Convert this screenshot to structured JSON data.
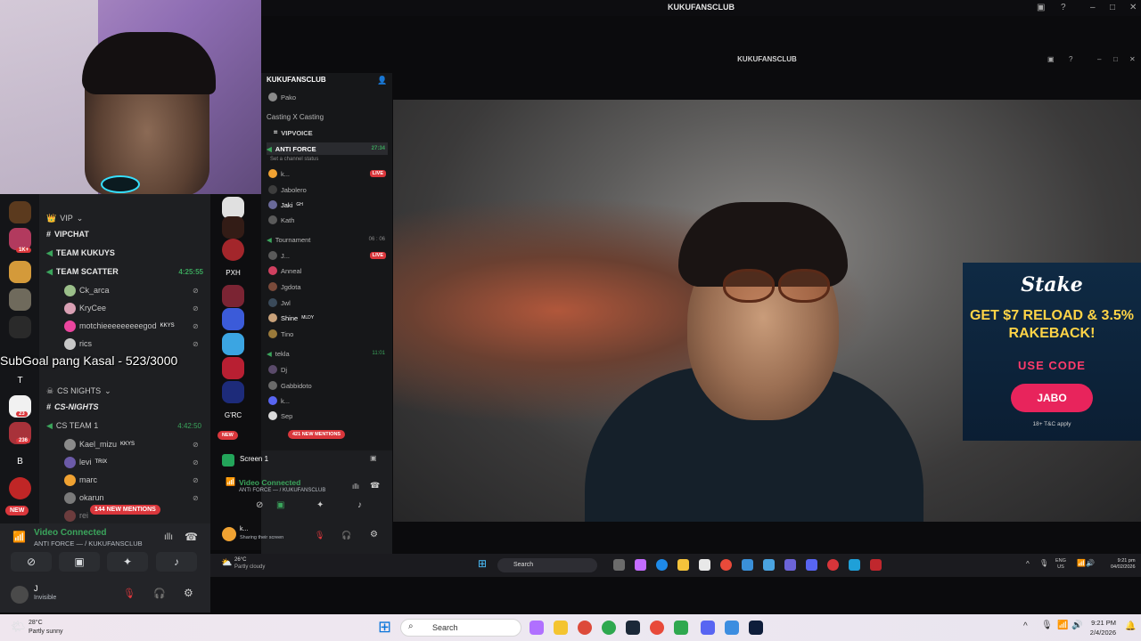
{
  "window": {
    "title": "KUKUFANSCLUB",
    "inner_title": "KUKUFANSCLUB"
  },
  "overlay": {
    "subgoal": "SubGoal pang Kasal - 523/3000"
  },
  "discord_left": {
    "guild_badges": [
      "1K+",
      "23",
      "236"
    ],
    "guild_letters": [
      "T",
      "B"
    ],
    "new_pill": "NEW",
    "channels": {
      "vip_category": "VIP",
      "vipchat": "VIPCHAT",
      "team_kukuys": "TEAM KUKUYS",
      "team_scatter": "TEAM SCATTER",
      "team_scatter_time": "4:25:55",
      "users_scatter": [
        "Ck_arca",
        "KryCee",
        "motchieeeeeeeeegod",
        "rics"
      ],
      "motchie_tag": "KKYS",
      "cs_category": "CS NIGHTS",
      "cs_nights": "CS-NIGHTS",
      "cs_team": "CS TEAM 1",
      "cs_team_time": "4:42:50",
      "users_cs": [
        "Kael_mizu",
        "levi",
        "marc",
        "okarun",
        "rei"
      ],
      "kael_tag": "KKYS",
      "levi_tag": "TRIX",
      "mentions": "144 NEW MENTIONS"
    },
    "voice": {
      "status": "Video Connected",
      "channel": "ANTI FORCE — / KUKUFANSCLUB"
    },
    "user": {
      "name": "J",
      "status": "Invisible"
    }
  },
  "discord_right": {
    "server": "KUKUFANSCLUB",
    "guild_labels": [
      "PXH",
      "G'RC"
    ],
    "new_pill": "NEW",
    "rows": [
      {
        "text": "Pako",
        "kind": "user"
      },
      {
        "text": "Casting X Casting",
        "kind": "channel"
      },
      {
        "text": "VIPVOICE",
        "kind": "category"
      },
      {
        "text": "ANTI FORCE",
        "kind": "voice-active",
        "time": "27:34"
      },
      {
        "text": "Set a channel status",
        "kind": "hint"
      },
      {
        "text": "k...",
        "kind": "user",
        "badge": "LIVE"
      },
      {
        "text": "Jabolero",
        "kind": "user"
      },
      {
        "text": "Jaki",
        "kind": "user",
        "tag": "GH"
      },
      {
        "text": "Kath",
        "kind": "user"
      },
      {
        "text": "Tournament",
        "kind": "voice",
        "time": "06 : 06"
      },
      {
        "text": "J...",
        "kind": "user",
        "badge": "LIVE"
      },
      {
        "text": "Anneal",
        "kind": "user"
      },
      {
        "text": "Jgdota",
        "kind": "user"
      },
      {
        "text": "Jwl",
        "kind": "user"
      },
      {
        "text": "Shine",
        "kind": "user",
        "tag": "MLDY"
      },
      {
        "text": "Tino",
        "kind": "user"
      },
      {
        "text": "tekla",
        "kind": "voice",
        "time": "11:01"
      },
      {
        "text": "Dj",
        "kind": "user"
      },
      {
        "text": "Gabbidoto",
        "kind": "user"
      },
      {
        "text": "k...",
        "kind": "user"
      },
      {
        "text": "Sep",
        "kind": "user"
      }
    ],
    "mentions": "421 NEW MENTIONS",
    "screen": "Screen 1",
    "voice": {
      "status": "Video Connected",
      "channel": "ANTI FORCE — / KUKUFANSCLUB"
    },
    "user": {
      "name": "k...",
      "status": "Sharing their screen"
    }
  },
  "ad": {
    "brand": "Stake",
    "headline": "GET $7 RELOAD & 3.5% RAKEBACK!",
    "use_code": "USE CODE",
    "code": "JABO",
    "terms": "18+ T&C apply"
  },
  "inner_taskbar": {
    "weather_temp": "26°C",
    "weather_desc": "Partly cloudy",
    "search": "Search",
    "lang": "ENG",
    "region": "US",
    "time": "9:21 pm",
    "date": "04/02/2026"
  },
  "taskbar": {
    "weather_temp": "28°C",
    "weather_desc": "Partly sunny",
    "search": "Search",
    "time": "9:21 PM",
    "date": "2/4/2026"
  },
  "colors": {
    "discord_bg": "#1e1f22",
    "voice_green": "#3ba55c",
    "alert_red": "#da373c",
    "ad_yellow": "#ffd447",
    "ad_pink": "#e8245c"
  }
}
